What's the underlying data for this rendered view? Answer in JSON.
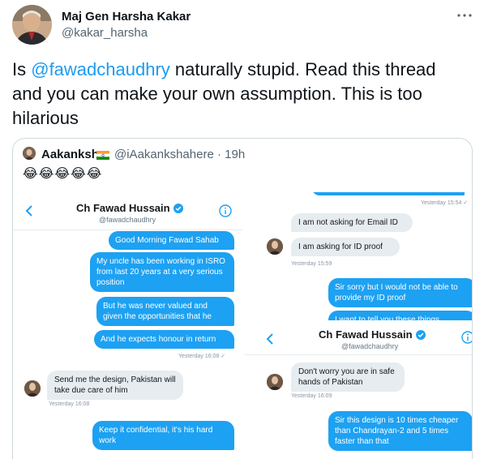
{
  "tweet": {
    "display_name": "Maj Gen Harsha Kakar",
    "handle": "@kakar_harsha",
    "text_before": "Is ",
    "mention": "@fawadchaudhry",
    "text_after": " naturally stupid. Read this thread and you can make your own assumption. This is too hilarious"
  },
  "quote": {
    "name": "Aakanksha",
    "handle_time": "@iAakankshahere · 19h",
    "emoji": "😂😂😂😂😂"
  },
  "shot_left": {
    "title": "Ch Fawad Hussain",
    "handle": "@fawadchaudhry",
    "msg1": "Good Morning Fawad Sahab",
    "msg2": "My uncle has been working in ISRO from last 20 years at a very serious position",
    "msg3": "But he was never valued and given the opportunities that he",
    "msg4": "And he expects honour in return",
    "stamp1": "Yesterday 16:08 ✓",
    "reply1": "Send me the design, Pakistan will take due care of him",
    "stamp2": "Yesterday 16:08",
    "msg5": "Keep it confidential, it's his hard work"
  },
  "shot_right_top": {
    "stamp0": "Yesterday 15:54 ✓",
    "in1": "I am not asking for Email ID",
    "in2": "I am asking for ID proof",
    "stamp1": "Yesterday 15:59",
    "out1": "Sir sorry but I would not be able to provide my ID proof",
    "out2": "I want to tell you these things"
  },
  "shot_right_bot": {
    "title": "Ch Fawad Hussain",
    "handle": "@fawadchaudhry",
    "in1": "Don't worry you are in safe hands of Pakistan",
    "stamp1": "Yesterday 16:09",
    "out1": "Sir this design is 10 times cheaper than Chandrayan-2 and 5 times faster than that"
  },
  "colors": {
    "accent": "#1d9bf0",
    "bubble_out": "#1da1f2",
    "bubble_in": "#e6ecf0",
    "verified": "#1da1f2"
  }
}
